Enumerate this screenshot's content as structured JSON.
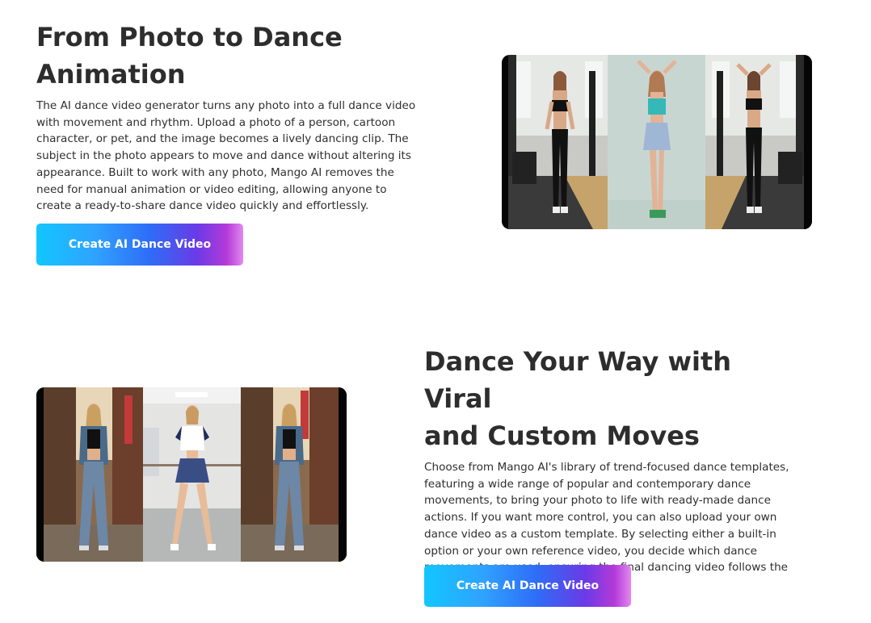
{
  "section1": {
    "heading_line1": "From Photo to Dance",
    "heading_line2": "Animation",
    "description": "The AI dance video generator turns any photo into a full dance video with movement and rhythm. Upload a photo of a person, cartoon character, or pet, and the image becomes a lively dancing clip. The subject in the photo appears to move and dance without altering its appearance. Built to work with any photo, Mango AI removes the need for manual animation or video editing, allowing anyone to create a ready-to-share dance video quickly and effortlessly.",
    "cta_label": "Create AI Dance Video"
  },
  "section2": {
    "heading_line1": "Dance Your Way with Viral",
    "heading_line2": "and Custom Moves",
    "description": "Choose from Mango AI's library of trend-focused dance templates, featuring a wide range of popular and contemporary dance movements, to bring your photo to life with ready-made dance actions. If you want more control, you can also upload your own dance video as a custom template. By selecting either a built-in option or your own reference video, you decide which dance movements are used, ensuring the final dancing video follows the style you choose.",
    "cta_label": "Create AI Dance Video"
  },
  "colors": {
    "heading": "#2d2d2d",
    "body_text": "#2f2f2f",
    "cta_gradient_start": "#12c6ff",
    "cta_gradient_end": "#e189f0"
  }
}
